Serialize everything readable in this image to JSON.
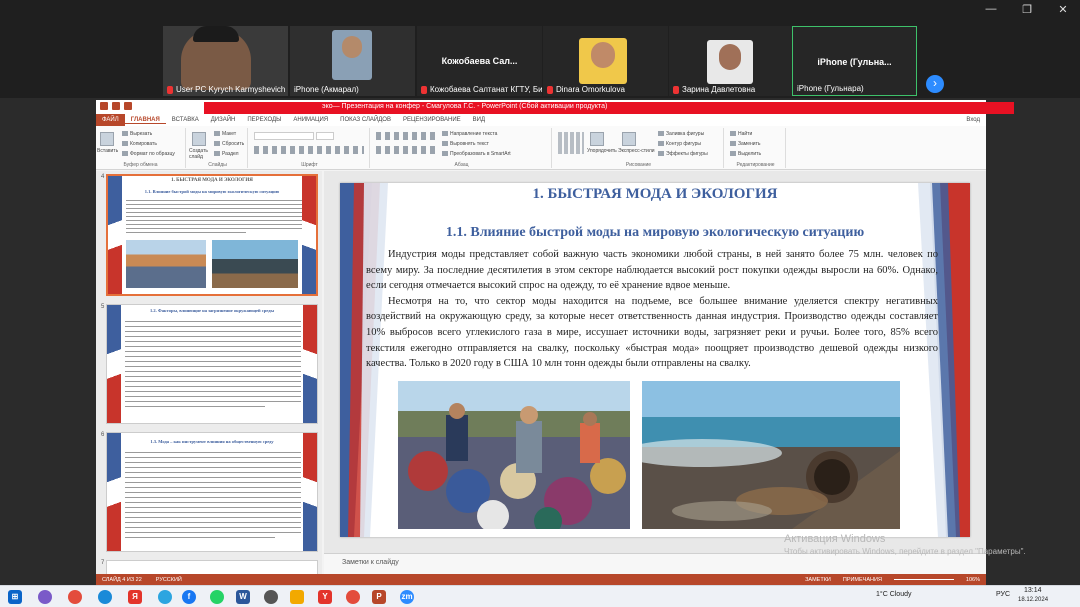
{
  "zoom": {
    "participants": [
      {
        "name": "User PC Kyrych Karmyshevich",
        "muted": true
      },
      {
        "name": "iPhone (Акмарал)",
        "muted": false
      },
      {
        "name": "Кожобаева Сал...",
        "caption": "Кожобаева Салтанат КГТУ, Биш...",
        "muted": true
      },
      {
        "name": "Dinara Omorkulova",
        "muted": true
      },
      {
        "name": "Зарина Давлетовна",
        "muted": true
      },
      {
        "name": "iPhone  (Гульна...",
        "caption": "iPhone (Гульнара)",
        "muted": false
      }
    ],
    "next_label": "›",
    "win_controls": [
      "—",
      "❐",
      "✕"
    ]
  },
  "powerpoint": {
    "title": "эко— Презентация на конфер - Смагулова Г.С. - PowerPoint (Сбой активации продукта)",
    "tabs": [
      "ФАЙЛ",
      "ГЛАВНАЯ",
      "ВСТАВКА",
      "ДИЗАЙН",
      "ПЕРЕХОДЫ",
      "АНИМАЦИЯ",
      "ПОКАЗ СЛАЙДОВ",
      "РЕЦЕНЗИРОВАНИЕ",
      "ВИД"
    ],
    "active_tab": "ГЛАВНАЯ",
    "sign_in": "Вход",
    "ribbon": {
      "paste": "Вставить",
      "cut": "Вырезать",
      "copy": "Копировать",
      "format_painter": "Формат по образцу",
      "clipboard_group": "Буфер обмена",
      "new_slide": "Создать слайд",
      "layout": "Макет",
      "reset": "Сбросить",
      "section": "Раздел",
      "slides_group": "Слайды",
      "font_group": "Шрифт",
      "text_direction": "Направление текста",
      "align_text": "Выровнять текст",
      "smartart": "Преобразовать в SmartArt",
      "paragraph_group": "Абзац",
      "arrange": "Упорядочить",
      "quick_styles": "Экспресс-стили",
      "shape_fill": "Заливка фигуры",
      "shape_outline": "Контур фигуры",
      "shape_effects": "Эффекты фигуры",
      "drawing_group": "Рисование",
      "find": "Найти",
      "replace": "Заменить",
      "select": "Выделить",
      "editing_group": "Редактирование"
    },
    "thumbnails": [
      {
        "number": "4",
        "title": "1. БЫСТРАЯ МОДА И ЭКОЛОГИЯ",
        "subtitle": "1.1. Влияние быстрой моды на мировую экологическую ситуацию",
        "selected": true
      },
      {
        "number": "5",
        "title": "",
        "subtitle": "1.2. Факторы, влияющие на загрязнение окружающей среды",
        "selected": false
      },
      {
        "number": "6",
        "title": "",
        "subtitle": "1.3. Мода – как инструмент влияния на общественную среду",
        "selected": false
      },
      {
        "number": "7",
        "title": "",
        "subtitle": "",
        "selected": false
      }
    ],
    "slide": {
      "title": "1. БЫСТРАЯ МОДА И ЭКОЛОГИЯ",
      "subtitle": "1.1. Влияние быстрой моды на мировую экологическую ситуацию",
      "paragraph1": "Индустрия моды представляет собой важную часть экономики любой страны, в ней занято более 75 млн. человек по всему миру. За последние десятилетия в этом секторе наблюдается высокий рост покупки одежды выросли на 60%. Однако, если сегодня отмечается высокий спрос на одежду, то её хранение вдвое меньше.",
      "paragraph2": "Несмотря на то, что сектор моды находится на подъеме, все большее внимание уделяется спектру негативных воздействий на окружающую среду, за которые несет ответственность данная индустрия. Производство одежды составляет 10% выбросов всего углекислого газа в мире, иссушает источники воды, загрязняет реки и ручьи. Более того, 85% всего текстиля ежегодно отправляется на свалку, поскольку «быстрая мода» поощряет производство дешевой одежды низкого качества. Только в 2020 году в США 10 млн тонн одежды были отправлены на свалку."
    },
    "notes_placeholder": "Заметки к слайду",
    "status": {
      "slide_info": "СЛАЙД 4 ИЗ 22",
      "language": "РУССКИЙ",
      "notes": "ЗАМЕТКИ",
      "comments": "ПРИМЕЧАНИЯ",
      "zoom": "106%"
    }
  },
  "activation": {
    "line1": "Активация Windows",
    "line2": "Чтобы активировать Windows, перейдите в раздел \"Параметры\"."
  },
  "taskbar": {
    "weather": "1°C  Cloudy",
    "lang": "РУС",
    "time": "13:14",
    "date": "18.12.2024"
  },
  "colors": {
    "accent": "#b7472a",
    "title_blue": "#3e5f9e",
    "zoom_blue": "#2d8cff",
    "active_green": "#3ec16a"
  }
}
